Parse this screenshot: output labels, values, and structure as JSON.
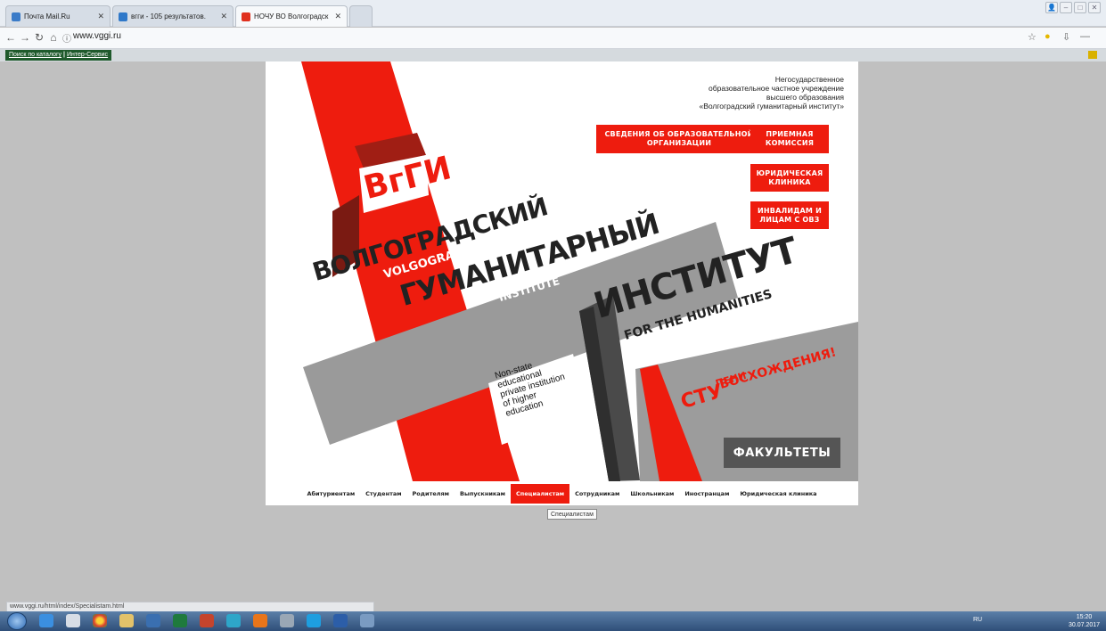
{
  "browser": {
    "tabs": [
      {
        "label": "Почта Mail.Ru",
        "active": false,
        "favicon_color": "#3a7bc8"
      },
      {
        "label": "вгги - 105 результатов.",
        "active": false,
        "favicon_color": "#2f78c9"
      },
      {
        "label": "НОЧУ ВО Волгоградск",
        "active": true,
        "favicon_color": "#e0301e"
      }
    ],
    "url": "www.vggi.ru",
    "bookmarks": {
      "item1": "Поиск по каталогу",
      "separator": "|",
      "item2": "Интер-Сервис"
    },
    "status_url": "www.vggi.ru/html/index/Specialistam.html"
  },
  "site": {
    "org_text": {
      "line1": "Негосударственное",
      "line2": "образовательное частное учреждение",
      "line3": "высшего образования",
      "line4": "«Волгоградский гуманитарный институт»"
    },
    "logo": "ВгГИ",
    "buttons": {
      "info": "СВЕДЕНИЯ ОБ ОБРАЗОВАТЕЛЬНОЙ ОРГАНИЗАЦИИ",
      "admission": "ПРИЕМНАЯ КОМИССИЯ",
      "legal_clinic": "ЮРИДИЧЕСКАЯ КЛИНИКА",
      "disabled": "ИНВАЛИДАМ И ЛИЦАМ С ОВЗ",
      "faculties": "ФАКУЛЬТЕТЫ"
    },
    "title_words": {
      "volgogradsky": "ВОЛГОГРАДСКИЙ",
      "volgograd": "VOLGOGRAD",
      "gumanitarny": "ГУМАНИТАРНЫЙ",
      "institute_en": "INSTITUTE",
      "institut": "ИНСТИТУТ",
      "for_humanities": "FOR THE HUMANITIES"
    },
    "non_state_text": {
      "line1": "Non-state",
      "line2": "educational",
      "line3": "private institution",
      "line4": "of higher",
      "line5": "education"
    },
    "slogan": {
      "stu": "СТУ",
      "peni": "ПЕНИ",
      "voskhozhdeniya": "ВОСХОЖДЕНИЯ!"
    },
    "nav": [
      {
        "label": "Абитуриентам",
        "active": false
      },
      {
        "label": "Студентам",
        "active": false
      },
      {
        "label": "Родителям",
        "active": false
      },
      {
        "label": "Выпускникам",
        "active": false
      },
      {
        "label": "Специалистам",
        "active": true
      },
      {
        "label": "Сотрудникам",
        "active": false
      },
      {
        "label": "Школьникам",
        "active": false
      },
      {
        "label": "Иностранцам",
        "active": false
      },
      {
        "label": "Юридическая клиника",
        "active": false
      }
    ],
    "tooltip": "Специалистам"
  },
  "taskbar": {
    "lang": "RU",
    "time": "15:20",
    "date": "30.07.2017"
  },
  "colors": {
    "accent_red": "#ee1c0e",
    "dark_gray": "#555555",
    "page_bg": "#c0c0c0"
  }
}
